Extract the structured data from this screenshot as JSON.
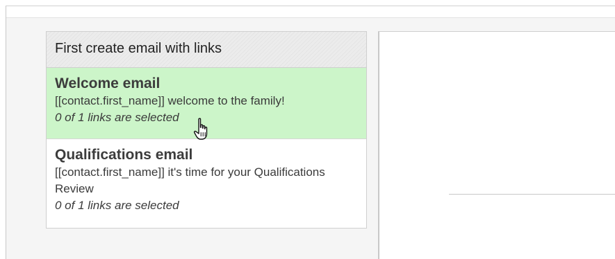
{
  "email_panel": {
    "header": "First create email with links",
    "items": [
      {
        "title": "Welcome email",
        "subject": "[[contact.first_name]] welcome to the family!",
        "status": "0 of 1 links are selected",
        "selected": true
      },
      {
        "title": "Qualifications email",
        "subject": "[[contact.first_name]] it's time for your Qualifications Review",
        "status": "0 of 1 links are selected",
        "selected": false
      }
    ]
  },
  "colors": {
    "selected_bg": "#ccf5c9",
    "header_bg": "#ececec",
    "frame_bg": "#f5f5f5"
  },
  "icons": {
    "cursor": "hand-pointer-icon"
  }
}
